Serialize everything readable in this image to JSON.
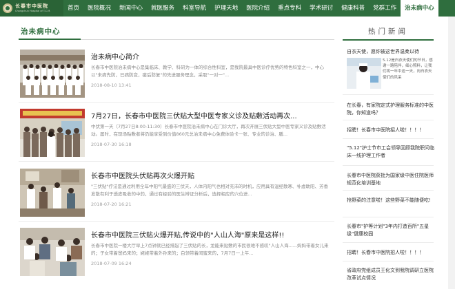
{
  "header": {
    "logo_cn": "长春市中医院",
    "logo_en": "Changchun Hospital of T.C.M.",
    "nav": [
      "首页",
      "医院概况",
      "新闻中心",
      "就医服务",
      "科室导航",
      "护理天地",
      "医院介绍",
      "重点专科",
      "学术研讨",
      "健康科普",
      "党群工作",
      "治未病中心"
    ],
    "active_index": 11
  },
  "main": {
    "section_title": "治未病中心",
    "articles": [
      {
        "title": "治未病中心简介",
        "summary": "长春市中医院治未病中心是集临床、教学、科研为一体的综合性科室，是我院最具中医诊疗优势的特色科室之一，中心以\"未病先防，已病防变，瘥后防复\"的先进服务理念，采取\"一对一\"...",
        "date": "2018-08-10 13:41"
      },
      {
        "title": "7月27日，长春市中医院三伏贴大型中医专家义诊及贴敷活动再次...",
        "summary": "中伏第一天（7月27日8:00-11:30）长春市中医院治未病中心在门诊大厅，再次开展三伏贴大型中医专家义诊及贴敷活动。届时，在现场贴敷者将仍能享受到价值860元总治未病中心免费体验卡一张、专业的诊治、膳...",
        "date": "2018-07-30 16:18"
      },
      {
        "title": "长春市中医院头伏贴再次火爆开贴",
        "summary": "\"三伏贴\"疗法是通过利用全年中阳气最盛的三伏天，人体内阳气也相对充沛的时机，应用具有温经散寒、补虚助阳、芳香发散有利于透皮吸收的中药，通过有经验的医生辨证分析后，选择相应的穴位进...",
        "date": "2018-07-20 16:21"
      },
      {
        "title": "长春市中医院三伏贴火爆开贴,传说中的\"人山人海\"原来是这样!!",
        "summary": "长春市中医院一楼大厅早上7点钟就已经排起了三伏贴的长，龙能来贴敷的市民很难不感叹\"人山人海......妈妈带着女儿来的；子女带着爸妈来的；姥姥带着外孙来的；白领带着闺蜜来的，7月7日一上午...",
        "date": "2018-07-09 16:24"
      }
    ]
  },
  "sidebar": {
    "title": "热门新闻",
    "first": "自衣天使，愿你被这世界温柔以待",
    "feature_text": "5.12是白衣天使们的节日，感谢一路陪伴，细心照料，让我们将一年中这一天，向白衣天使们的风采",
    "items": [
      "在长春，有家院定式护理服务标准的中医院，你知道吗？",
      "招聘！长春市中医院招人啦！！！！",
      "\"5.12\"护士节市工会领导回顾我院职问临床一线护理工作者",
      "长春市中医院获批为国家级中医住院医师规范化培训基地",
      "抢野菜的注意啦！这些野菜不能随便吃!",
      "长春市\"护等计划\"3年内打造百所\"五星级\"健康校园",
      "招聘！长春市中医院招人啦！！！！",
      "省政府党组成员王化文到我院调研立医院改革试点情况"
    ]
  },
  "colors": {
    "brand": "#2f6e3e",
    "nav_active_bg": "#ffffff"
  }
}
